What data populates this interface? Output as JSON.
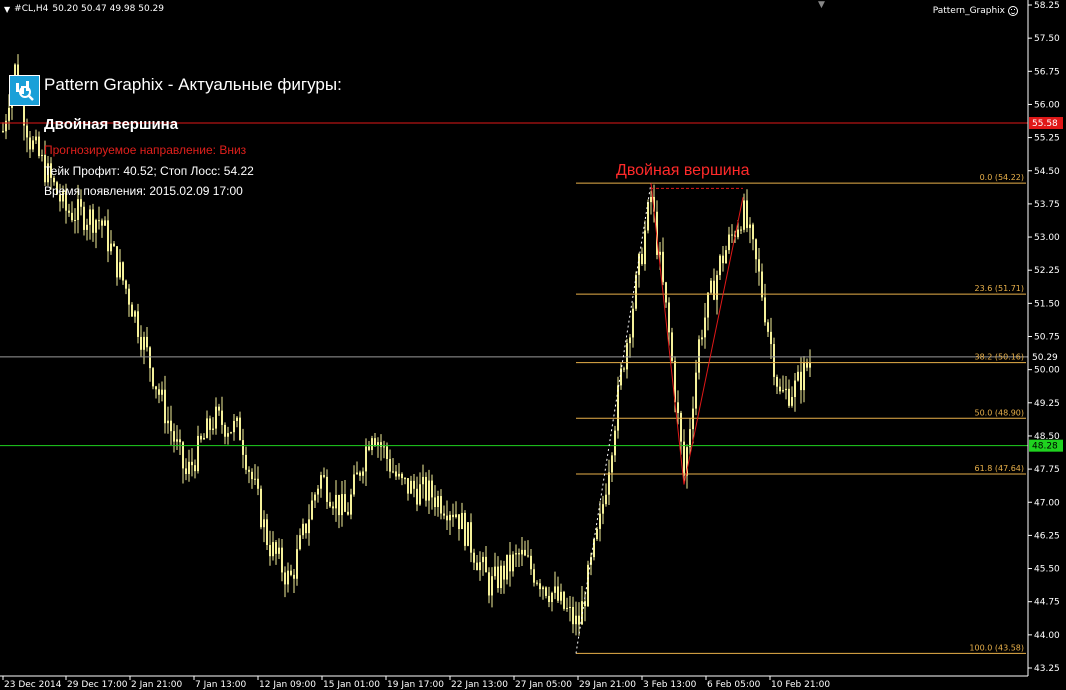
{
  "header": {
    "symbol": "#CL,H4",
    "ohlc": "50.20 50.47 49.98 50.29"
  },
  "indicator_name": "Pattern_Graphix",
  "overlay": {
    "title": "Pattern Graphix - Актуальные фигуры:",
    "pattern_name": "Двойная вершина",
    "direction": "Прогнозируемое направление: Вниз",
    "take_stop": "Тейк Профит: 40.52; Стоп Лосс: 54.22",
    "appearance_time": "Время появления: 2015.02.09 17:00"
  },
  "pattern_label": "Двойная вершина",
  "colors": {
    "background": "#000000",
    "candles": "#f5f19a",
    "fib": "#e8b04a",
    "red_line": "#e01818",
    "green_line": "#1fd21f",
    "grey_line": "#9a9a9a",
    "axis_text": "#ffffff"
  },
  "price_axis": {
    "ticks": [
      "58.25",
      "57.50",
      "56.75",
      "56.00",
      "55.25",
      "54.50",
      "53.75",
      "53.00",
      "52.25",
      "51.50",
      "50.75",
      "50.00",
      "49.25",
      "48.50",
      "47.75",
      "47.00",
      "46.25",
      "45.50",
      "44.75",
      "44.00",
      "43.25"
    ]
  },
  "time_axis": {
    "labels": [
      "23 Dec 2014",
      "29 Dec 17:00",
      "2 Jan 21:00",
      "7 Jan 13:00",
      "12 Jan 09:00",
      "15 Jan 01:00",
      "19 Jan 17:00",
      "22 Jan 13:00",
      "27 Jan 05:00",
      "29 Jan 21:00",
      "3 Feb 13:00",
      "6 Feb 05:00",
      "10 Feb 21:00"
    ]
  },
  "levels": {
    "red": {
      "price": 55.58,
      "label": "55.58"
    },
    "green": {
      "price": 48.28,
      "label": "48.28"
    },
    "current": {
      "price": 50.29,
      "label": "50.29"
    }
  },
  "fibo": [
    {
      "level": "0.0",
      "price": 54.22,
      "label": "0.0 (54.22)"
    },
    {
      "level": "23.6",
      "price": 51.71,
      "label": "23.6 (51.71)"
    },
    {
      "level": "38.2",
      "price": 50.16,
      "label": "38.2 (50.16)"
    },
    {
      "level": "50.0",
      "price": 48.9,
      "label": "50.0 (48.90)"
    },
    {
      "level": "61.8",
      "price": 47.64,
      "label": "61.8 (47.64)"
    },
    {
      "level": "100.0",
      "price": 43.58,
      "label": "100.0 (43.58)"
    }
  ],
  "chart_data": {
    "type": "bar",
    "symbol": "#CL",
    "timeframe": "H4",
    "ylim": [
      43.0,
      58.4
    ],
    "anchors": [
      {
        "t": "23 Dec 2014",
        "price": 55.8
      },
      {
        "t": "29 Dec 17:00",
        "price": 53.7
      },
      {
        "t": "2 Jan 21:00",
        "price": 51.8
      },
      {
        "t": "7 Jan 13:00",
        "price": 48.6
      },
      {
        "t": "12 Jan 09:00",
        "price": 45.7
      },
      {
        "t": "15 Jan 01:00",
        "price": 48.4
      },
      {
        "t": "19 Jan 17:00",
        "price": 47.9
      },
      {
        "t": "22 Jan 13:00",
        "price": 46.8
      },
      {
        "t": "27 Jan 05:00",
        "price": 45.5
      },
      {
        "t": "29 Jan 21:00",
        "price": 44.3
      },
      {
        "t": "3 Feb 13:00",
        "price": 53.8
      },
      {
        "t": "6 Feb 05:00",
        "price": 51.8
      },
      {
        "t": "10 Feb 21:00",
        "price": 50.29
      }
    ],
    "pattern": {
      "name": "Двойная вершина",
      "points": [
        {
          "t": "29 Jan 21:00",
          "price": 43.58
        },
        {
          "t": "3 Feb 13:00",
          "price": 54.22
        },
        {
          "t": "6 Feb 05:00",
          "price": 47.4
        },
        {
          "t": "6 Feb 05:00",
          "price": 53.9
        }
      ]
    }
  }
}
